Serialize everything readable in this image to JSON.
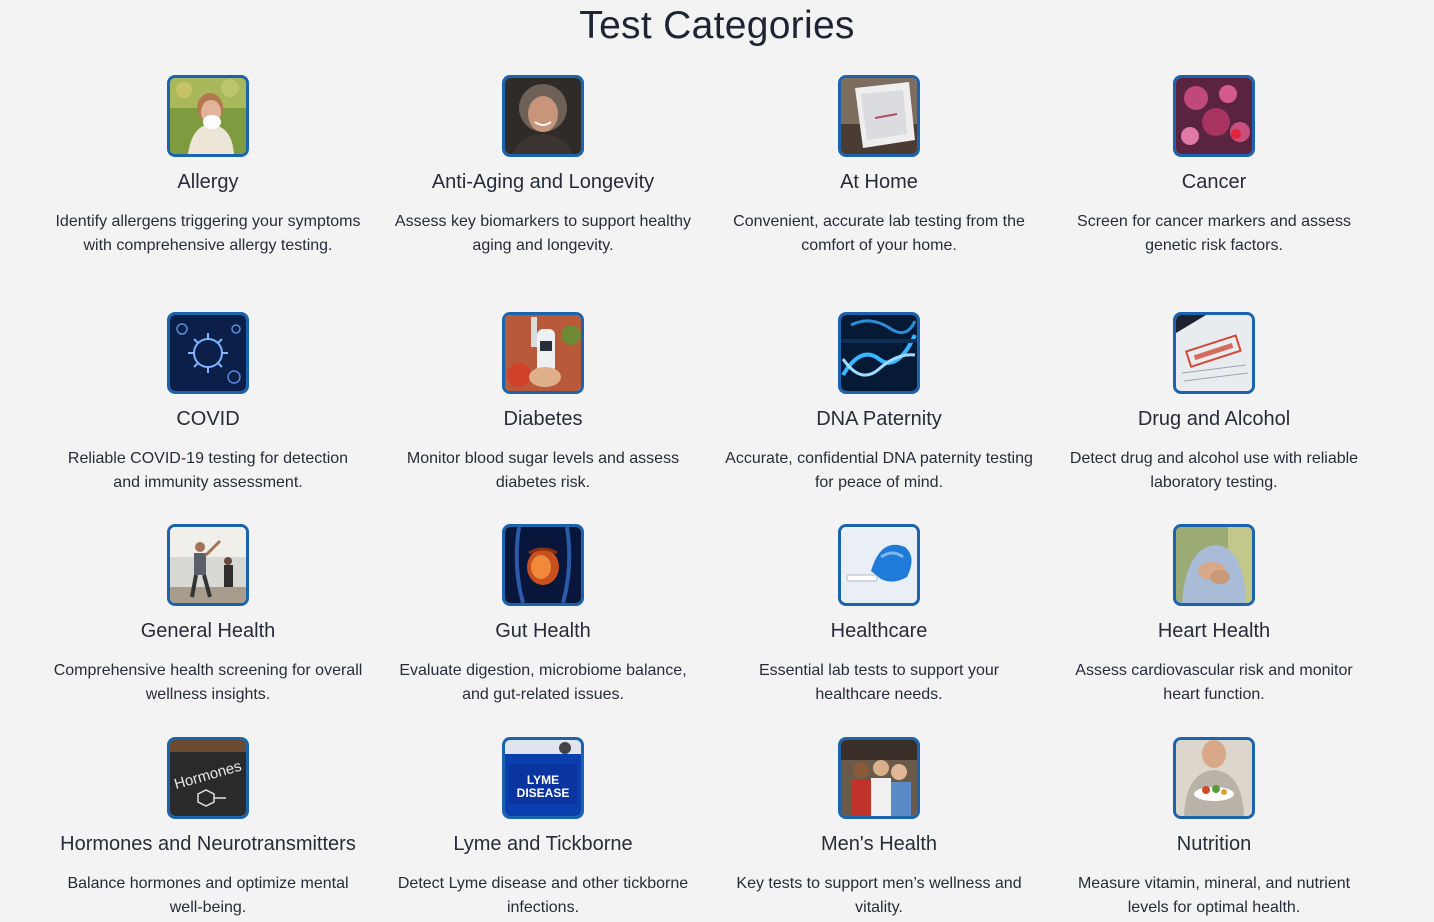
{
  "page": {
    "title": "Test Categories"
  },
  "categories": [
    {
      "name": "Allergy",
      "description": "Identify allergens triggering your symptoms with comprehensive allergy testing.",
      "image": "woman-sneezing-tissue"
    },
    {
      "name": "Anti-Aging and Longevity",
      "description": "Assess key biomarkers to support healthy aging and longevity.",
      "image": "smiling-older-woman"
    },
    {
      "name": "At Home",
      "description": "Convenient, accurate lab testing from the comfort of your home.",
      "image": "home-test-kit"
    },
    {
      "name": "Cancer",
      "description": "Screen for cancer markers and assess genetic risk factors.",
      "image": "cancer-cells"
    },
    {
      "name": "COVID",
      "description": "Reliable COVID-19 testing for detection and immunity assessment.",
      "image": "coronavirus"
    },
    {
      "name": "Diabetes",
      "description": "Monitor blood sugar levels and assess diabetes risk.",
      "image": "glucose-meter"
    },
    {
      "name": "DNA Paternity",
      "description": "Accurate, confidential DNA paternity testing for peace of mind.",
      "image": "dna-helix"
    },
    {
      "name": "Drug and Alcohol",
      "description": "Detect drug and alcohol use with reliable laboratory testing.",
      "image": "drug-test-passed"
    },
    {
      "name": "General Health",
      "description": "Comprehensive health screening for overall wellness insights.",
      "image": "exercise-class"
    },
    {
      "name": "Gut Health",
      "description": "Evaluate digestion, microbiome balance, and gut-related issues.",
      "image": "digestive-system"
    },
    {
      "name": "Healthcare",
      "description": "Essential lab tests to support your healthcare needs.",
      "image": "gloved-hand-sample"
    },
    {
      "name": "Heart Health",
      "description": "Assess cardiovascular risk and monitor heart function.",
      "image": "man-holding-chest"
    },
    {
      "name": "Hormones and Neurotransmitters",
      "description": "Balance hormones and optimize mental well-being.",
      "image": "hormones-chalkboard",
      "image_text": "Hormones"
    },
    {
      "name": "Lyme and Tickborne",
      "description": "Detect Lyme disease and other tickborne infections.",
      "image": "lyme-disease-sign",
      "image_text": "LYME DISEASE"
    },
    {
      "name": "Men's Health",
      "description": "Key tests to support men’s wellness and vitality.",
      "image": "group-of-men"
    },
    {
      "name": "Nutrition",
      "description": "Measure vitamin, mineral, and nutrient levels for optimal health.",
      "image": "woman-with-salad"
    }
  ],
  "colors": {
    "background": "#f3f3f3",
    "thumb_border": "#1b64ad",
    "text": "#262c38"
  }
}
